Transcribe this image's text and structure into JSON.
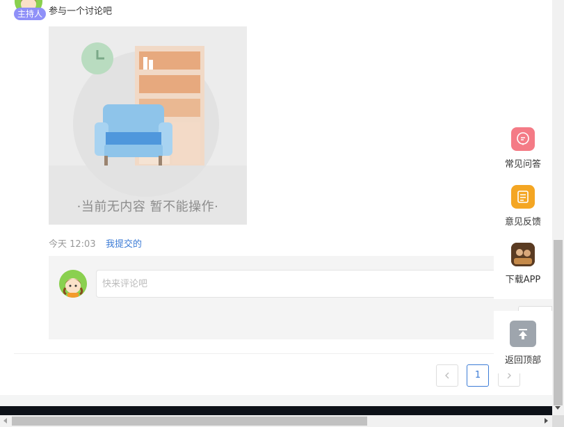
{
  "post": {
    "host_badge": "主持人",
    "topic_text": "参与一个讨论吧",
    "empty_image_text": "·当前无内容 暂不能操作·",
    "time": "今天 12:03",
    "submitted_link": "我提交的"
  },
  "comment": {
    "placeholder": "快来评论吧"
  },
  "pagination": {
    "prev_icon": "chevron-left-icon",
    "current_page": "1",
    "next_icon": "chevron-right-icon"
  },
  "side_toolbar": {
    "items": [
      {
        "label": "常见问答",
        "icon": "chat-bubble-icon",
        "color": "#f47b86"
      },
      {
        "label": "意见反馈",
        "icon": "feedback-icon",
        "color": "#f4a623"
      },
      {
        "label": "下载APP",
        "icon": "app-icon",
        "color": "#6b4a2e"
      }
    ],
    "back_to_top": {
      "label": "返回顶部",
      "icon": "arrow-up-icon",
      "color": "#9ea5ad"
    }
  },
  "colors": {
    "accent_blue": "#3b7bd6",
    "host_badge": "#8f90f8",
    "footer": "#0d1118"
  }
}
